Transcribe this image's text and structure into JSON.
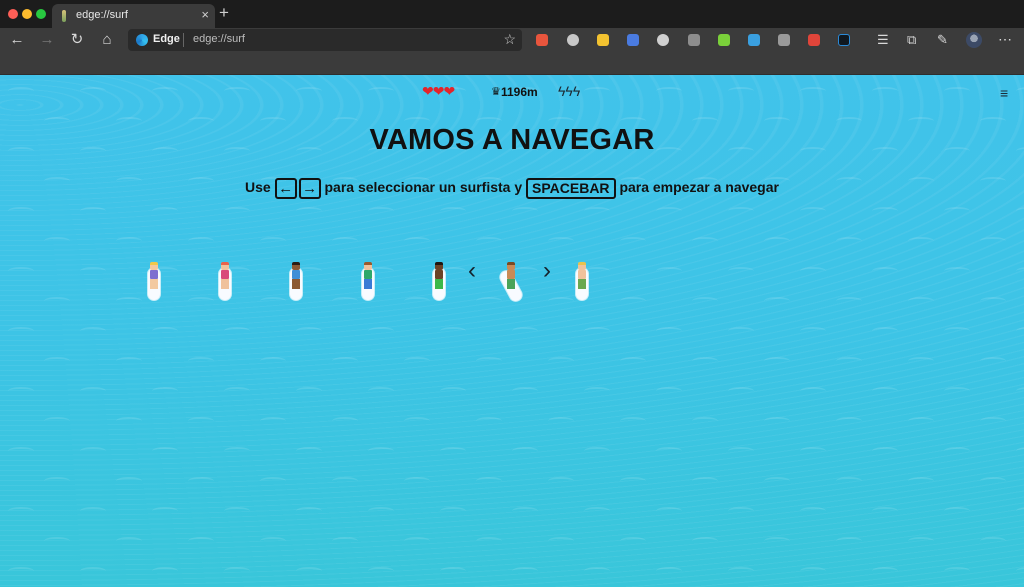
{
  "browser": {
    "tab_title": "edge://surf",
    "tab_close": "×",
    "new_tab": "+",
    "address_brand": "Edge",
    "address_url": "edge://surf",
    "nav": {
      "back": "←",
      "forward": "→",
      "reload": "↻",
      "home": "⌂"
    },
    "star": "☆",
    "more": "⋯"
  },
  "game": {
    "hearts": "❤❤❤",
    "crown": "♛",
    "distance": "1196m",
    "bolts": "ϟϟϟ",
    "menu": "≡",
    "headline": "VAMOS A NAVEGAR",
    "instructions": {
      "use": "Use",
      "left_key": "←",
      "right_key": "→",
      "middle": "para seleccionar un surfista y",
      "space_key": "SPACEBAR",
      "end": "para empezar a navegar"
    },
    "prev_arrow": "‹",
    "next_arrow": "›",
    "selected_surfer_index": 5,
    "surfers": [
      {
        "hair": "#f0c84a",
        "skin": "#f3c9a0",
        "top": "#7d6fd0",
        "legs": "#f3c9a0"
      },
      {
        "hair": "#e8624a",
        "skin": "#f0c29c",
        "top": "#d94a7a",
        "legs": "#f0c29c"
      },
      {
        "hair": "#2c1e14",
        "skin": "#8c5a33",
        "top": "#3f8fd8",
        "legs": "#8c5a33"
      },
      {
        "hair": "#9a5a2c",
        "skin": "#f0c29c",
        "top": "#2fa86a",
        "legs": "#3a7bd5"
      },
      {
        "hair": "#1f1610",
        "skin": "#6b4226",
        "top": "#6b4226",
        "legs": "#3bb84a"
      },
      {
        "hair": "#7a4a22",
        "skin": "#c98a55",
        "top": "#c98a55",
        "legs": "#4aa35a"
      },
      {
        "hair": "#e9c34e",
        "skin": "#f0c29c",
        "top": "#f0c29c",
        "legs": "#6aa84f"
      }
    ]
  }
}
